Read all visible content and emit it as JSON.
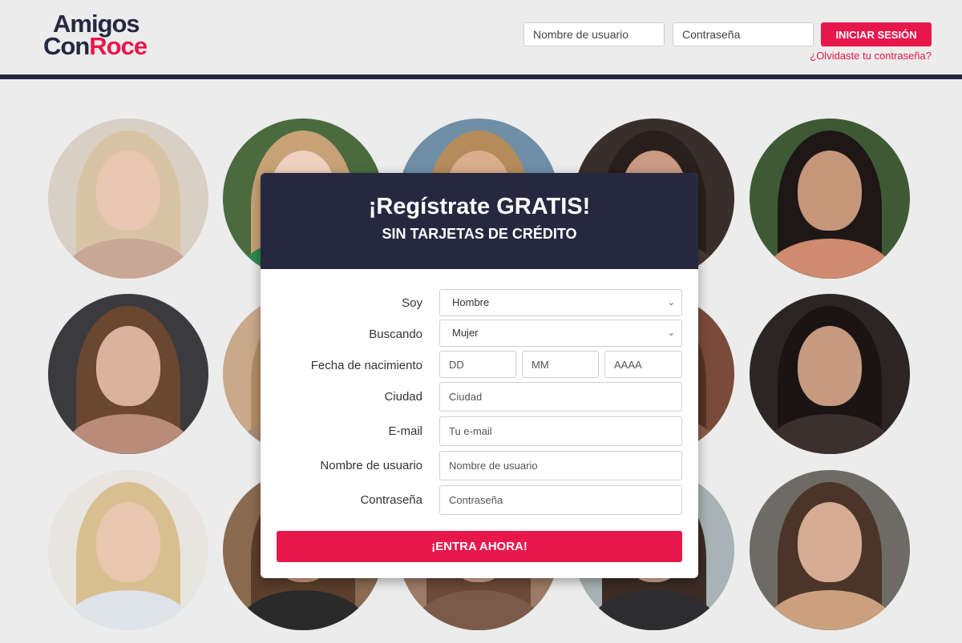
{
  "logo": {
    "line1": "Amigos",
    "line2_a": "Con",
    "line2_b": "Roce"
  },
  "header": {
    "username_placeholder": "Nombre de usuario",
    "password_placeholder": "Contraseña",
    "login_label": "INICIAR SESIÓN",
    "forgot_label": "¿Olvidaste tu contraseña?"
  },
  "modal": {
    "title": "¡Regístrate GRATIS!",
    "subtitle": "SIN TARJETAS DE CRÉDITO",
    "labels": {
      "soy": "Soy",
      "buscando": "Buscando",
      "fecha": "Fecha de nacimiento",
      "ciudad": "Ciudad",
      "email": "E-mail",
      "usuario": "Nombre de usuario",
      "password": "Contraseña"
    },
    "values": {
      "soy": "Hombre",
      "buscando": "Mujer"
    },
    "placeholders": {
      "dd": "DD",
      "mm": "MM",
      "aaaa": "AAAA",
      "ciudad": "Ciudad",
      "email": "Tu e-mail",
      "usuario": "Nombre de usuario",
      "password": "Contraseña"
    },
    "cta": "¡ENTRA AHORA!"
  },
  "colors": {
    "brand_red": "#e8174b",
    "brand_navy": "#262840"
  },
  "icons": {
    "select_arrow": "chevron-down-icon"
  }
}
